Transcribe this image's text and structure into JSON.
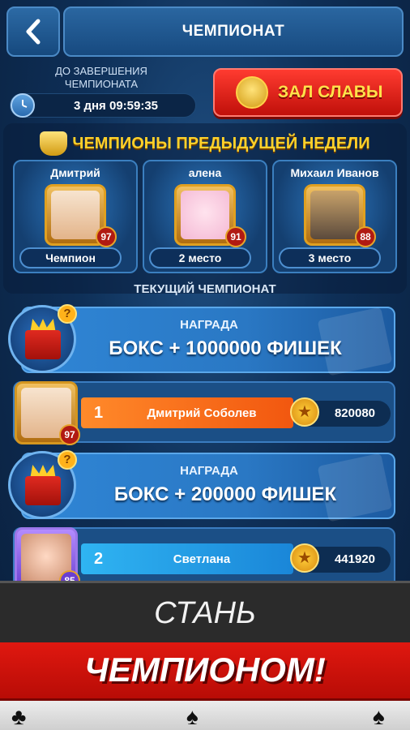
{
  "header": {
    "title": "ЧЕМПИОНАТ",
    "back_icon": "chevron-left-icon"
  },
  "timer": {
    "label_line1": "ДО ЗАВЕРШЕНИЯ",
    "label_line2": "ЧЕМПИОНАТА",
    "value": "3 дня 09:59:35",
    "icon": "clock-icon"
  },
  "hall_of_fame": {
    "label": "ЗАЛ СЛАВЫ",
    "icon": "trophy-icon"
  },
  "previous_champions": {
    "title": "ЧЕМПИОНЫ ПРЕДЫДУЩЕЙ НЕДЕЛИ",
    "cards": [
      {
        "name": "Дмитрий",
        "level": "97",
        "place": "Чемпион"
      },
      {
        "name": "алена",
        "level": "91",
        "place": "2 место"
      },
      {
        "name": "Михаил Иванов",
        "level": "88",
        "place": "3 место"
      }
    ]
  },
  "current": {
    "label": "ТЕКУЩИЙ ЧЕМПИОНАТ",
    "prizes": [
      {
        "label": "НАГРАДА",
        "value": "БОКС + 1000000 ФИШЕК"
      },
      {
        "label": "НАГРАДА",
        "value": "БОКС + 200000 ФИШЕК"
      }
    ],
    "ranks": [
      {
        "rank": "1",
        "name": "Дмитрий Соболев",
        "score": "820080",
        "level": "97"
      },
      {
        "rank": "2",
        "name": "Светлана",
        "score": "441920",
        "level": "85"
      }
    ]
  },
  "promo": {
    "line1": "СТАНЬ",
    "line2": "ЧЕМПИОНОМ!"
  },
  "colors": {
    "accent_gold": "#ffd12a",
    "button_red": "#e01810",
    "rank1_bar": "#ff6a1a",
    "rank2_bar": "#1f9fe6"
  }
}
